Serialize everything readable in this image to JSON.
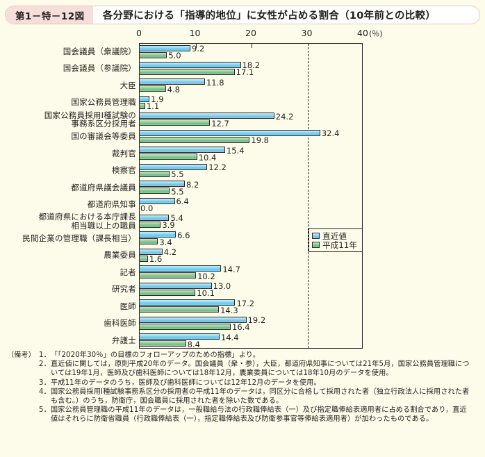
{
  "header": {
    "figure_number": "第1－特－12図",
    "title": "各分野における「指導的地位」に女性が占める割合（10年前との比較）"
  },
  "legend": {
    "recent_label": "直近値",
    "y11_label": "平成11年",
    "recent_color": "#7fd0ef",
    "y11_color": "#8ecb9c"
  },
  "axis": {
    "unit": "(％)",
    "ticks": [
      "0",
      "10",
      "20",
      "30",
      "40"
    ],
    "target_line": "30"
  },
  "notes": {
    "label": "（備考）",
    "items": [
      {
        "num": "1．",
        "text": "「「2020年30％」の目標のフォローアップのための指標」より。"
      },
      {
        "num": "2．",
        "text": "直近値に関しては，原則平成20年のデータ。国会議員（衆・参），大臣，都道府県知事については21年5月，国家公務員管理職については19年1月，医師及び歯科医師については18年12月，農業委員については18年10月のデータを使用。"
      },
      {
        "num": "3．",
        "text": "平成11年のデータのうち，医師及び歯科医師については12年12月のデータを使用。"
      },
      {
        "num": "4．",
        "text": "国家公務員採用Ⅰ種試験事務系区分の採用者の平成11年のデータは，同区分に合格して採用された者（独立行政法人に採用された者も含む。）のうち，防衛庁，国会職員に採用された者を除いた数である。"
      },
      {
        "num": "5．",
        "text": "国家公務員管理職の平成11年のデータは，一般職給与法の行政職俸給表（一）及び指定職俸給表適用者に占める割合であり，直近値はそれらに防衛省職員（行政職俸給表（一），指定職俸給表及び防衛参事官等俸給表適用者）が加わったものである。"
      }
    ]
  },
  "chart_data": {
    "type": "bar",
    "orientation": "horizontal",
    "title": "各分野における「指導的地位」に女性が占める割合（10年前との比較）",
    "xlabel": "(％)",
    "ylabel": "",
    "xlim": [
      0,
      40
    ],
    "xticks": [
      0,
      10,
      20,
      30,
      40
    ],
    "grid": false,
    "reference_line": 30,
    "legend_position": "inside-right",
    "categories": [
      "国会議員（衆議院）",
      "国会議員（参議院）",
      "大臣",
      "国家公務員管理職",
      "国家公務員採用Ⅰ種試験の\n事務系区分採用者",
      "国の審議会等委員",
      "裁判官",
      "検察官",
      "都道府県議会議員",
      "都道府県知事",
      "都道府県における本庁課長\n相当職以上の職員",
      "民間企業の管理職（課長相当）",
      "農業委員",
      "記者",
      "研究者",
      "医師",
      "歯科医師",
      "弁護士"
    ],
    "series": [
      {
        "name": "直近値",
        "color": "#7fd0ef",
        "values": [
          9.2,
          18.2,
          11.8,
          1.9,
          24.2,
          32.4,
          15.4,
          12.2,
          8.2,
          6.4,
          5.4,
          6.6,
          4.2,
          14.7,
          13.0,
          17.2,
          19.2,
          14.4
        ]
      },
      {
        "name": "平成11年",
        "color": "#8ecb9c",
        "values": [
          5.0,
          17.1,
          4.8,
          1.1,
          12.7,
          19.8,
          10.4,
          5.5,
          5.5,
          0.0,
          3.9,
          3.4,
          1.6,
          10.2,
          10.1,
          14.3,
          16.4,
          8.4
        ]
      }
    ]
  }
}
